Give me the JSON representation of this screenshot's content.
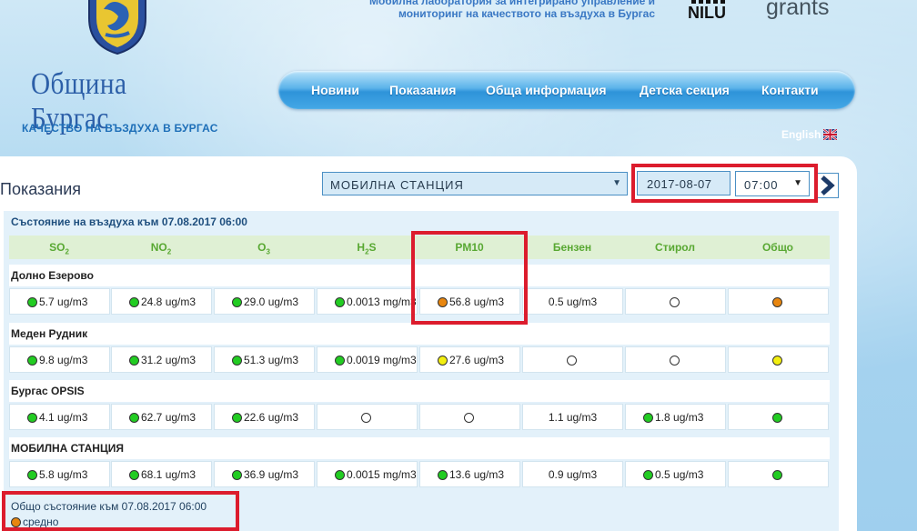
{
  "header": {
    "logo_text": "Община Бургас",
    "tagline": "КАЧЕСТВО НА ВЪЗДУХА В БУРГАС",
    "description_line1": "Мобилна лаборатория за интегрирано управление и",
    "description_line2": "мониторинг на качеството на въздуха в Бургас",
    "partner1": "NILU",
    "partner2": "grants"
  },
  "nav": {
    "items": [
      "Новини",
      "Показания",
      "Обща информация",
      "Детска секция",
      "Контакти"
    ]
  },
  "language": {
    "label": "English",
    "flag_icon": "uk-flag-icon"
  },
  "page": {
    "title": "Показания",
    "station_select": "МОБИЛНА СТАНЦИЯ",
    "date": "2017-08-07",
    "time": "07:00",
    "status_header": "Състояние на въздуха към 07.08.2017 06:00"
  },
  "colors": {
    "green": "#22cc22",
    "orange": "#e8860f",
    "yellow": "#f2ee10",
    "empty": "#ffffff",
    "highlight": "#dc1c2d",
    "header_green": "#58a832"
  },
  "table": {
    "columns": [
      {
        "main": "SO",
        "sub": "2"
      },
      {
        "main": "NO",
        "sub": "2"
      },
      {
        "main": "O",
        "sub": "3"
      },
      {
        "main": "H",
        "sub": "2",
        "tail": "S"
      },
      {
        "main": "PM10"
      },
      {
        "main": "Бензен"
      },
      {
        "main": "Стирол"
      },
      {
        "main": "Общо"
      }
    ],
    "stations": [
      {
        "name": "Долно Езерово",
        "cells": [
          {
            "status": "green",
            "value": "5.7 ug/m3"
          },
          {
            "status": "green",
            "value": "24.8 ug/m3"
          },
          {
            "status": "green",
            "value": "29.0 ug/m3"
          },
          {
            "status": "green",
            "value": "0.0013 mg/m3"
          },
          {
            "status": "orange",
            "value": "56.8 ug/m3"
          },
          {
            "status": "none",
            "value": "0.5 ug/m3"
          },
          {
            "status": "empty",
            "value": ""
          },
          {
            "status": "orange",
            "value": ""
          }
        ]
      },
      {
        "name": "Меден Рудник",
        "cells": [
          {
            "status": "green",
            "value": "9.8 ug/m3"
          },
          {
            "status": "green",
            "value": "31.2 ug/m3"
          },
          {
            "status": "green",
            "value": "51.3 ug/m3"
          },
          {
            "status": "green",
            "value": "0.0019 mg/m3"
          },
          {
            "status": "yellow",
            "value": "27.6 ug/m3"
          },
          {
            "status": "empty",
            "value": ""
          },
          {
            "status": "empty",
            "value": ""
          },
          {
            "status": "yellow",
            "value": ""
          }
        ]
      },
      {
        "name": "Бургас OPSIS",
        "cells": [
          {
            "status": "green",
            "value": "4.1 ug/m3"
          },
          {
            "status": "green",
            "value": "62.7 ug/m3"
          },
          {
            "status": "green",
            "value": "22.6 ug/m3"
          },
          {
            "status": "empty",
            "value": ""
          },
          {
            "status": "empty",
            "value": ""
          },
          {
            "status": "none",
            "value": "1.1 ug/m3"
          },
          {
            "status": "green",
            "value": "1.8 ug/m3"
          },
          {
            "status": "green",
            "value": ""
          }
        ]
      },
      {
        "name": "МОБИЛНА СТАНЦИЯ",
        "cells": [
          {
            "status": "green",
            "value": "5.8 ug/m3"
          },
          {
            "status": "green",
            "value": "68.1 ug/m3"
          },
          {
            "status": "green",
            "value": "36.9 ug/m3"
          },
          {
            "status": "green",
            "value": "0.0015 mg/m3"
          },
          {
            "status": "green",
            "value": "13.6 ug/m3"
          },
          {
            "status": "none",
            "value": "0.9 ug/m3"
          },
          {
            "status": "green",
            "value": "0.5 ug/m3"
          },
          {
            "status": "green",
            "value": ""
          }
        ]
      }
    ]
  },
  "summary": {
    "header": "Общо състояние към 07.08.2017 06:00",
    "status": "orange",
    "label": "средно"
  }
}
